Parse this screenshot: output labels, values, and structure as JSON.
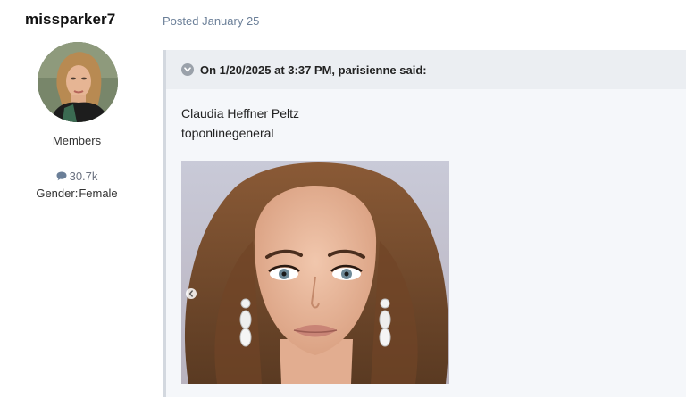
{
  "author": {
    "username": "missparker7",
    "group": "Members",
    "post_count": "30.7k",
    "gender_label": "Gender:",
    "gender_value": "Female"
  },
  "post": {
    "posted_label": "Posted January 25",
    "quote": {
      "header": "On 1/20/2025 at 3:37 PM, parisienne said:",
      "lines": [
        "Claudia Heffner Peltz",
        "toponlinegeneral"
      ]
    }
  },
  "icons": {
    "quote_toggle": "chevron-down-icon",
    "post_count": "comment-bubble-icon",
    "image_prev": "chevron-left-icon"
  },
  "colors": {
    "posted_text": "#6b7f98",
    "quote_bg": "#f5f7fa",
    "quote_header_bg": "#ebeef2",
    "quote_border": "#d3d8df"
  }
}
